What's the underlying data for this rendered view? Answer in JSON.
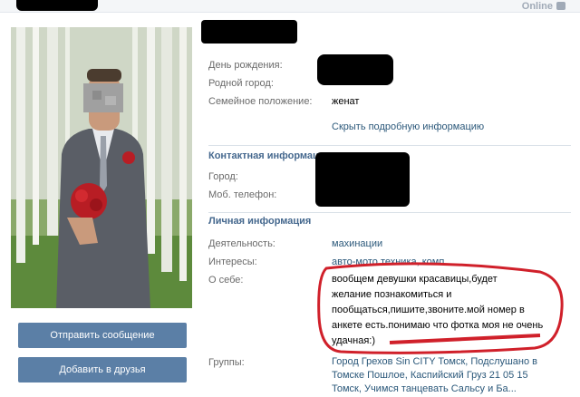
{
  "header": {
    "online_label": "Online"
  },
  "profile": {
    "birthday_label": "День рождения:",
    "hometown_label": "Родной город:",
    "marital_label": "Семейное положение:",
    "marital_value": "женат",
    "hide_details": "Скрыть подробную информацию"
  },
  "contacts": {
    "title": "Контактная информация",
    "city_label": "Город:",
    "phone_label": "Моб. телефон:"
  },
  "personal": {
    "title": "Личная информация",
    "activity_label": "Деятельность:",
    "activity_value": "махинации",
    "interests_label": "Интересы:",
    "interests_value": "авто-мото техника, комп",
    "about_label": "О себе:",
    "about_lines": [
      "вообщем девушки красавицы,будет",
      "желание познакомиться и",
      "пообщаться,пишите,звоните.мой номер в",
      "анкете есть.понимаю что фотка моя не очень",
      "удачная:)"
    ],
    "groups_label": "Группы:",
    "groups_lines": [
      "Город Грехов Sin CITY Томск, Подслушано в",
      "Томске Пошлое, Каспийский Груз 21 05 15",
      "Томск, Учимся танцевать Сальсу и Ба..."
    ]
  },
  "actions": {
    "send_message": "Отправить сообщение",
    "add_friend": "Добавить в друзья"
  },
  "colors": {
    "link": "#2b587a",
    "section_title": "#45688e",
    "button_bg": "#5b7fa6",
    "annotation": "#d0202a"
  },
  "icons": [
    "online-phone-icon"
  ]
}
